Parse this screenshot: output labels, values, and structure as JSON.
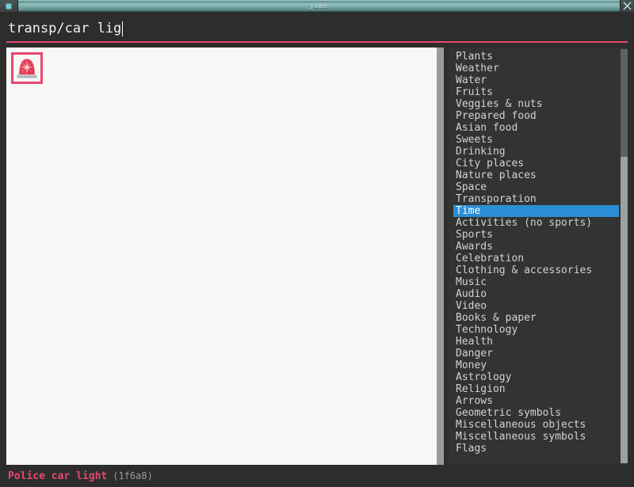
{
  "window": {
    "title": "jome",
    "menu_icon": "window-menu-icon",
    "close_icon": "close-icon"
  },
  "search": {
    "value": "transp/car lig",
    "placeholder": "Search emoji",
    "accent_color": "#e8476f"
  },
  "results": {
    "panel_background": "#f7f7f5",
    "selection_color": "#e8476f",
    "emojis": [
      {
        "name": "Police car light",
        "codepoint": "1f6a8",
        "glyph": "🚨",
        "selected": true
      }
    ]
  },
  "categories": {
    "selected": "Time",
    "highlight_color": "#2a8fd5",
    "items": [
      {
        "label": "Plants"
      },
      {
        "label": "Weather"
      },
      {
        "label": "Water"
      },
      {
        "label": "Fruits"
      },
      {
        "label": "Veggies & nuts"
      },
      {
        "label": "Prepared food"
      },
      {
        "label": "Asian food"
      },
      {
        "label": "Sweets"
      },
      {
        "label": "Drinking"
      },
      {
        "label": "City places"
      },
      {
        "label": "Nature places"
      },
      {
        "label": "Space"
      },
      {
        "label": "Transporation"
      },
      {
        "label": "Time"
      },
      {
        "label": "Activities (no sports)"
      },
      {
        "label": "Sports"
      },
      {
        "label": "Awards"
      },
      {
        "label": "Celebration"
      },
      {
        "label": "Clothing & accessories"
      },
      {
        "label": "Music"
      },
      {
        "label": "Audio"
      },
      {
        "label": "Video"
      },
      {
        "label": "Books & paper"
      },
      {
        "label": "Technology"
      },
      {
        "label": "Health"
      },
      {
        "label": "Danger"
      },
      {
        "label": "Money"
      },
      {
        "label": "Astrology"
      },
      {
        "label": "Religion"
      },
      {
        "label": "Arrows"
      },
      {
        "label": "Geometric symbols"
      },
      {
        "label": "Miscellaneous objects"
      },
      {
        "label": "Miscellaneous symbols"
      },
      {
        "label": "Flags"
      }
    ]
  },
  "status": {
    "name": "Police car light",
    "codepoint": "(1f6a8)",
    "name_color": "#e8476f",
    "code_color": "#9a9a9a"
  }
}
